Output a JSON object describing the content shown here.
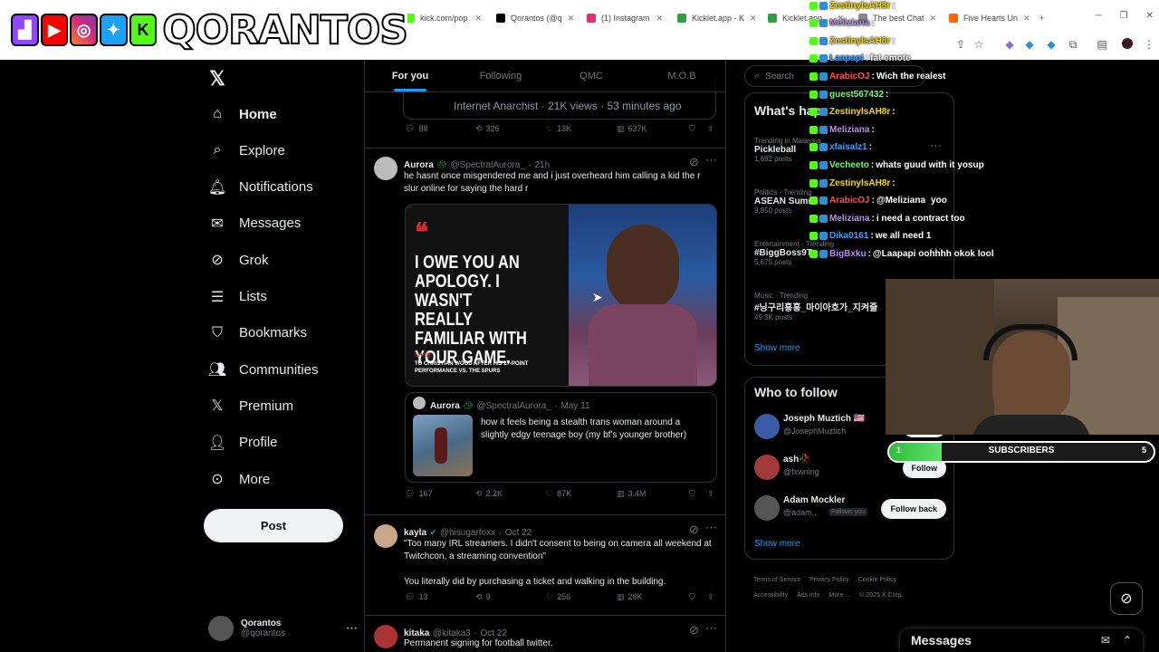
{
  "browser": {
    "tabs": [
      {
        "title": "kick.com/pop",
        "color": "#53fc18"
      },
      {
        "title": "Qorantos (@q",
        "color": "#000000"
      },
      {
        "title": "(1) Instagram",
        "color": "#e1306c"
      },
      {
        "title": "Kicklet.app - K",
        "color": "#2f9e44"
      },
      {
        "title": "Kicklet.app",
        "color": "#2f9e44"
      },
      {
        "title": "The best Chat",
        "color": "#888888"
      },
      {
        "title": "Five Hearts Un",
        "color": "#ff6600"
      }
    ],
    "new_tab": "+"
  },
  "overlay": {
    "logo_text": "QORANTOS",
    "social_icons": [
      "twitch-icon",
      "youtube-icon",
      "instagram-icon",
      "twitter-icon",
      "kick-icon"
    ],
    "subscribers_label": "SUBSCRIBERS",
    "subscribers_current": "1",
    "subscribers_goal": "5",
    "subscribers_progress": 0.2
  },
  "chat": [
    {
      "user": "ZestinylsAH8r",
      "msg": "",
      "color": "#f5d90a"
    },
    {
      "user": "Meliziana",
      "msg": "",
      "color": "#b88cf0"
    },
    {
      "user": "ZestinylsAH8r",
      "msg": "",
      "color": "#f5d90a"
    },
    {
      "user": "Laapapi",
      "msg": "fat emote",
      "color": "#3aa0ff"
    },
    {
      "user": "ArabicOJ",
      "msg": "Wich the realest",
      "color": "#ff4d4d"
    },
    {
      "user": "guest567432",
      "msg": "",
      "color": "#7cf07c"
    },
    {
      "user": "ZestinylsAH8r",
      "msg": "",
      "color": "#f5d90a"
    },
    {
      "user": "Meliziana",
      "msg": "",
      "color": "#b88cf0"
    },
    {
      "user": "xfaisalz1",
      "msg": "",
      "color": "#3aa0ff"
    },
    {
      "user": "Vecheeto",
      "msg": "whats guud with it yosup",
      "color": "#7cf07c"
    },
    {
      "user": "ZestinylsAH8r",
      "msg": "",
      "color": "#f5d90a"
    },
    {
      "user": "ArabicOJ",
      "msg": "@Meliziana",
      "msg2": "yoo",
      "color": "#ff4d4d"
    },
    {
      "user": "Meliziana",
      "msg": "i need a contract too",
      "color": "#b88cf0"
    },
    {
      "user": "Dika0161",
      "msg": "we all need 1",
      "color": "#3aa0ff"
    },
    {
      "user": "BigBxku",
      "msg": "@Laapapi oohhhh okok lool",
      "color": "#b88cf0"
    }
  ],
  "nav": {
    "items": [
      {
        "label": "Home",
        "icon": "home-icon",
        "active": true
      },
      {
        "label": "Explore",
        "icon": "search-icon"
      },
      {
        "label": "Notifications",
        "icon": "bell-icon"
      },
      {
        "label": "Messages",
        "icon": "envelope-icon"
      },
      {
        "label": "Grok",
        "icon": "grok-icon"
      },
      {
        "label": "Lists",
        "icon": "list-icon"
      },
      {
        "label": "Bookmarks",
        "icon": "bookmark-icon"
      },
      {
        "label": "Communities",
        "icon": "people-icon"
      },
      {
        "label": "Premium",
        "icon": "x-icon"
      },
      {
        "label": "Profile",
        "icon": "person-icon"
      },
      {
        "label": "More",
        "icon": "more-circle-icon"
      }
    ],
    "post_label": "Post",
    "profile_name": "Qorantos",
    "profile_handle": "@qorantos"
  },
  "timeline": {
    "tabs": [
      "For you",
      "Following",
      "QMC",
      "M.O.B"
    ],
    "top_card": {
      "text1": "Internet Anarchist",
      "views": "21K views",
      "ago": "53 minutes ago"
    },
    "top_actions": {
      "replies": "88",
      "reposts": "326",
      "likes": "13K",
      "views": "637K"
    },
    "tweet1": {
      "name": "Aurora",
      "handle": "@SpectralAurora_",
      "time": "21h",
      "text": "he hasnt once misgendered me and i just overheard him calling a kid the r slur online for saying the hard r",
      "image_text": "I OWE YOU AN APOLOGY. I WASN'T REALLY FAMILIAR WITH YOUR GAME.",
      "image_caption_small": "SHAQ",
      "image_caption": "TO CHRISTIAN WOOD AFTER HIS 27-POINT PERFORMANCE VS. THE SPURS",
      "quote_name": "Aurora",
      "quote_handle": "@SpectralAurora_",
      "quote_time": "May 11",
      "quote_text": "how it feels being a stealth trans woman around a slightly edgy teenage boy (my bf's younger brother)",
      "actions": {
        "replies": "167",
        "reposts": "2.2K",
        "likes": "87K",
        "views": "3.4M"
      }
    },
    "tweet2": {
      "name": "kayla",
      "handle": "@hisugarfoxx",
      "time": "Oct 22",
      "text": "\"Too many IRL streamers. I didn't consent to being on camera all weekend at Twitchcon, a streaming convention\"",
      "text2": "You literally did by purchasing a ticket and walking in the building.",
      "actions": {
        "replies": "13",
        "reposts": "9",
        "likes": "256",
        "views": "28K"
      }
    },
    "tweet3": {
      "name": "kitaka",
      "handle": "@kitaka3",
      "time": "Oct 22",
      "text": "Permanent signing for football twitter."
    }
  },
  "right": {
    "search_placeholder": "Search",
    "happening_title": "What's hap",
    "trends": [
      {
        "meta": "Trending in Malaysia",
        "name": "Pickleball",
        "count": "1,692 posts"
      },
      {
        "meta": "Politics · Trending",
        "name": "ASEAN Summ",
        "count": "9,850 posts"
      },
      {
        "meta": "Entertainment · Trending",
        "name": "#BiggBoss9T",
        "count": "5,675 posts"
      },
      {
        "meta": "Music · Trending",
        "name": "#닝구리홍홍_마이아호가_지켜줄",
        "count": "49.3K posts"
      }
    ],
    "show_more": "Show more",
    "who_to_follow": "Who to follow",
    "follow": [
      {
        "name": "Joseph Muztich 🇺🇸",
        "handle": "@JosephMuztich",
        "btn": "Follow"
      },
      {
        "name": "ash🥀",
        "handle": "@fxwning",
        "btn": "Follow"
      },
      {
        "name": "Adam Mockler",
        "handle": "@adam...",
        "follows_you": "Follows you",
        "btn": "Follow back"
      }
    ],
    "footer": [
      "Terms of Service",
      "Privacy Policy",
      "Cookie Policy",
      "Accessibility",
      "Ads info",
      "More ...",
      "© 2025 X Corp."
    ]
  },
  "messages_dock": {
    "title": "Messages"
  }
}
